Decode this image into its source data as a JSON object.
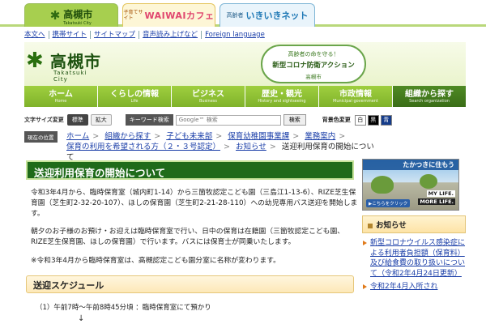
{
  "site_tabs": {
    "city": {
      "name": "高槻市",
      "sub": "Takatsuki City"
    },
    "waiwai": {
      "small": "子育てサイト",
      "big": "WAIWAIカフェ"
    },
    "ikiiki": {
      "small": "高齢者",
      "big": "いきいきネット"
    }
  },
  "utility_links": [
    "本文へ",
    "携帯サイト",
    "サイトマップ",
    "音声読み上げなど",
    "Foreign language"
  ],
  "header": {
    "logo_name": "高槻市",
    "logo_en": "Takatsuki City",
    "banner": {
      "line1": "高齢者の命を守る！",
      "line2": "新型コロナ防衛アクション",
      "line3": "高槻市"
    }
  },
  "gnav": [
    {
      "jp": "ホーム",
      "en": "Home"
    },
    {
      "jp": "くらしの情報",
      "en": "Life"
    },
    {
      "jp": "ビジネス",
      "en": "Business"
    },
    {
      "jp": "歴史・観光",
      "en": "History and sightseeing"
    },
    {
      "jp": "市政情報",
      "en": "Municipal government"
    },
    {
      "jp": "組織から探す",
      "en": "Search organization"
    }
  ],
  "toolbar": {
    "font_size_label": "文字サイズ変更",
    "size_standard": "標準",
    "size_large": "拡大",
    "keyword_label": "キーワード検索",
    "search_placeholder": "Google™ 検索",
    "search_button": "検索",
    "bg_label": "背景色変更",
    "bg_white": "白",
    "bg_black": "黒",
    "bg_blue": "青"
  },
  "breadcrumb": {
    "label": "現在の位置",
    "links": [
      "ホーム",
      "組織から探す",
      "子ども未来部",
      "保育幼稚園事業課",
      "業務案内",
      "保育の利用を希望される方（２・３号認定）",
      "お知らせ"
    ],
    "current": "送迎利用保育の開始について"
  },
  "content": {
    "title": "送迎利用保育の開始について",
    "para1": "令和3年4月から、臨時保育室（城内町1-14）から三箇牧認定こども園（三島江1-13-6）、RIZE芝生保育園（芝生町2-32-20-107）、ほしの保育園（芝生町2-21-28-110）への幼児専用バス送迎を開始します。",
    "para2": "朝夕のお子様のお預け・お迎えは臨時保育室で行い、日中の保育は在籍園（三箇牧認定こども園、RIZE芝生保育園、ほしの保育園）で行います。バスには保育士が同乗いたします。",
    "para3": "※令和3年4月から臨時保育室は、高槻認定こども園分室に名称が変わります。",
    "section_title": "送迎スケジュール",
    "schedule_item": "（1）午前7時〜午前8時45分頃 ：臨時保育室にて預かり",
    "arrow": "↓"
  },
  "sidebar": {
    "ad": {
      "top": "たかつきに住もう",
      "mylife": "MY LIFE.",
      "more": "MORE LIFE.",
      "click": "▶こちらをクリック"
    },
    "news_title": "お知らせ",
    "news": [
      "新型コロナウイルス感染症による利用者負担額（保育料）及び給食費の取り扱いについて（令和2年4月24日更新）",
      "令和2年4月入所され"
    ]
  }
}
